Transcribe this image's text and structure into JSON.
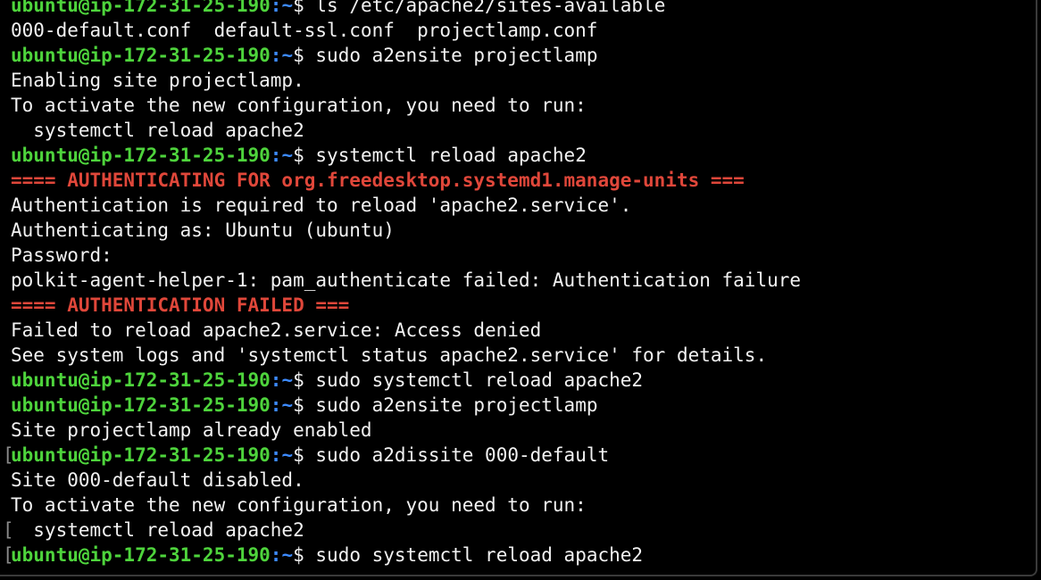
{
  "prompt": {
    "user_host": "ubuntu@ip-172-31-25-190",
    "separator": ":",
    "path": "~",
    "symbol": "$ "
  },
  "lines": [
    {
      "type": "prompt",
      "text": "ls /etc/apache2/sites-available"
    },
    {
      "type": "output",
      "text": "000-default.conf  default-ssl.conf  projectlamp.conf"
    },
    {
      "type": "prompt",
      "text": "sudo a2ensite projectlamp"
    },
    {
      "type": "output",
      "text": "Enabling site projectlamp."
    },
    {
      "type": "output",
      "text": "To activate the new configuration, you need to run:"
    },
    {
      "type": "output",
      "text": "  systemctl reload apache2"
    },
    {
      "type": "prompt",
      "text": "systemctl reload apache2"
    },
    {
      "type": "alert",
      "text": "==== AUTHENTICATING FOR org.freedesktop.systemd1.manage-units ==="
    },
    {
      "type": "output",
      "text": "Authentication is required to reload 'apache2.service'."
    },
    {
      "type": "output",
      "text": "Authenticating as: Ubuntu (ubuntu)"
    },
    {
      "type": "output",
      "text": "Password:"
    },
    {
      "type": "output",
      "text": "polkit-agent-helper-1: pam_authenticate failed: Authentication failure"
    },
    {
      "type": "alert",
      "text": "==== AUTHENTICATION FAILED ==="
    },
    {
      "type": "output",
      "text": "Failed to reload apache2.service: Access denied"
    },
    {
      "type": "output",
      "text": "See system logs and 'systemctl status apache2.service' for details."
    },
    {
      "type": "prompt",
      "text": "sudo systemctl reload apache2"
    },
    {
      "type": "prompt",
      "text": "sudo a2ensite projectlamp"
    },
    {
      "type": "output",
      "text": "Site projectlamp already enabled"
    },
    {
      "type": "prompt",
      "text": "sudo a2dissite 000-default",
      "bracket": true
    },
    {
      "type": "output",
      "text": "Site 000-default disabled."
    },
    {
      "type": "output",
      "text": "To activate the new configuration, you need to run:"
    },
    {
      "type": "output",
      "text": "  systemctl reload apache2",
      "bracket": true
    },
    {
      "type": "prompt",
      "text": "sudo systemctl reload apache2",
      "bracket": true
    }
  ],
  "bracket_char": "[",
  "colors": {
    "background": "#000000",
    "text": "#f2f2f2",
    "prompt_user": "#4ed43c",
    "prompt_path": "#3d8bff",
    "alert": "#e0473a"
  }
}
